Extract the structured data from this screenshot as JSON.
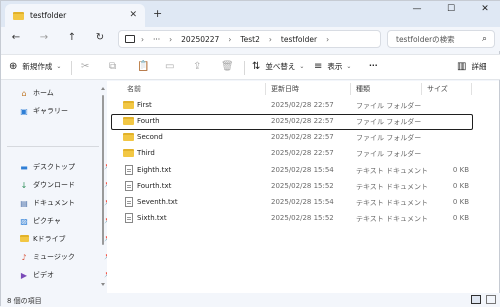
{
  "window": {
    "tab_title": "testfolder",
    "new_tab": "+",
    "tab_close": "✕",
    "controls": {
      "minimize": "—",
      "maximize": "☐",
      "close": "✕"
    }
  },
  "nav": {
    "back": "←",
    "forward": "→",
    "up": "↑",
    "refresh": "↻",
    "more": "···",
    "breadcrumb": [
      "20250227",
      "Test2",
      "testfolder"
    ],
    "separator": "›",
    "search_placeholder": "testfolderの検索"
  },
  "commandbar": {
    "new_label": "新規作成",
    "sort_label": "並べ替え",
    "view_label": "表示",
    "more_label": "···",
    "details_label": "詳細"
  },
  "sidebar": {
    "top_items": [
      {
        "label": "ホーム",
        "icon": "home-icon"
      },
      {
        "label": "ギャラリー",
        "icon": "gallery-icon"
      }
    ],
    "pinned_items": [
      {
        "label": "デスクトップ",
        "icon": "desktop-icon"
      },
      {
        "label": "ダウンロード",
        "icon": "download-icon"
      },
      {
        "label": "ドキュメント",
        "icon": "documents-icon"
      },
      {
        "label": "ピクチャ",
        "icon": "pictures-icon"
      },
      {
        "label": "Kドライブ",
        "icon": "folder-icon"
      },
      {
        "label": "ミュージック",
        "icon": "music-icon"
      },
      {
        "label": "ビデオ",
        "icon": "video-icon"
      }
    ]
  },
  "filelist": {
    "columns": {
      "name": "名前",
      "date": "更新日時",
      "type": "種類",
      "size": "サイズ"
    },
    "rows": [
      {
        "name": "First",
        "date": "2025/02/28 22:57",
        "type": "ファイル フォルダー",
        "size": "",
        "kind": "folder"
      },
      {
        "name": "Fourth",
        "date": "2025/02/28 22:57",
        "type": "ファイル フォルダー",
        "size": "",
        "kind": "folder",
        "selected": true
      },
      {
        "name": "Second",
        "date": "2025/02/28 22:57",
        "type": "ファイル フォルダー",
        "size": "",
        "kind": "folder"
      },
      {
        "name": "Third",
        "date": "2025/02/28 22:57",
        "type": "ファイル フォルダー",
        "size": "",
        "kind": "folder"
      },
      {
        "name": "Eighth.txt",
        "date": "2025/02/28 15:54",
        "type": "テキスト ドキュメント",
        "size": "0 KB",
        "kind": "txt"
      },
      {
        "name": "Fourth.txt",
        "date": "2025/02/28 15:52",
        "type": "テキスト ドキュメント",
        "size": "0 KB",
        "kind": "txt"
      },
      {
        "name": "Seventh.txt",
        "date": "2025/02/28 15:54",
        "type": "テキスト ドキュメント",
        "size": "0 KB",
        "kind": "txt"
      },
      {
        "name": "Sixth.txt",
        "date": "2025/02/28 15:52",
        "type": "テキスト ドキュメント",
        "size": "0 KB",
        "kind": "txt"
      }
    ]
  },
  "statusbar": {
    "item_count": "8 個の項目"
  }
}
